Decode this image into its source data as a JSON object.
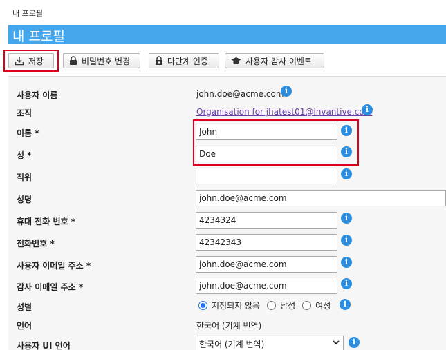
{
  "breadcrumb": "내 프로필",
  "page_title": "내 프로필",
  "toolbar": {
    "save": "저장",
    "change_password": "비밀번호 변경",
    "mfa": "다단계 인증",
    "audit_events": "사용자 감사 이벤트"
  },
  "fields": {
    "username": {
      "label": "사용자 이름",
      "value": "john.doe@acme.com"
    },
    "organisation": {
      "label": "조직",
      "value": "Organisation for jhatest01@invantive.com"
    },
    "first_name": {
      "label": "이름 *",
      "value": "John"
    },
    "last_name": {
      "label": "성 *",
      "value": "Doe"
    },
    "job_title": {
      "label": "직위",
      "value": ""
    },
    "full_name": {
      "label": "성명",
      "value": "john.doe@acme.com"
    },
    "mobile": {
      "label": "휴대 전화 번호 *",
      "value": "4234324"
    },
    "phone": {
      "label": "전화번호 *",
      "value": "42342343"
    },
    "user_email": {
      "label": "사용자 이메일 주소 *",
      "value": "john.doe@acme.com"
    },
    "audit_email": {
      "label": "감사 이메일 주소 *",
      "value": "john.doe@acme.com"
    },
    "gender": {
      "label": "성별",
      "options": [
        "지정되지 않음",
        "남성",
        "여성"
      ],
      "selected": "지정되지 않음"
    },
    "language": {
      "label": "언어",
      "value": "한국어 (기계 번역)"
    },
    "ui_language": {
      "label": "사용자 UI 언어",
      "value": "한국어 (기계 번역)"
    }
  },
  "colors": {
    "title_bar": "#45a6eb",
    "highlight": "#e0001b",
    "info_icon": "#2b8ee0",
    "link": "#6b3fa0"
  },
  "icons": {
    "info": "i"
  }
}
